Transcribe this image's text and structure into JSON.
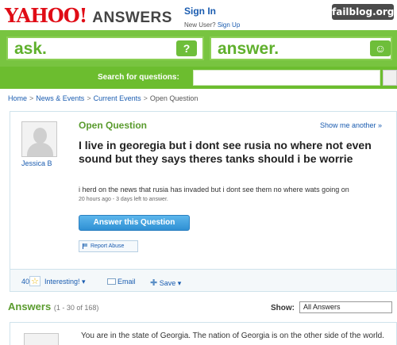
{
  "header": {
    "logo_yahoo": "YAHOO",
    "logo_excl": "!",
    "logo_answers": "ANSWERS",
    "sign_in": "Sign In",
    "new_user": "New User?",
    "sign_up": "Sign Up",
    "watermark": "failblog.org"
  },
  "askbar": {
    "ask": "ask.",
    "answer": "answer.",
    "ask_icon": "?",
    "answer_icon": "☺"
  },
  "search": {
    "label": "Search for questions:"
  },
  "breadcrumb": [
    "Home",
    "News & Events",
    "Current Events",
    "Open Question"
  ],
  "question": {
    "asker": "Jessica B",
    "status": "Open Question",
    "show_another": "Show me another »",
    "title": "I live in georegia but i dont see rusia no where not even sound but they says theres tanks should i be worrie",
    "detail": "i herd on the news that rusia has invaded but i dont see them no where wats going on",
    "meta": "20 hours ago - 3 days left to answer.",
    "answer_button": "Answer this Question",
    "report_abuse": "Report Abuse"
  },
  "actions": {
    "interesting_count": "40",
    "interesting": "Interesting!",
    "email": "Email",
    "save": "Save"
  },
  "answers": {
    "title": "Answers",
    "range": "(1 - 30 of 168)",
    "show_label": "Show:",
    "show_value": "All Answers",
    "first_answer": "You are in the state of Georgia. The nation of Georgia is on the other side of the world."
  }
}
